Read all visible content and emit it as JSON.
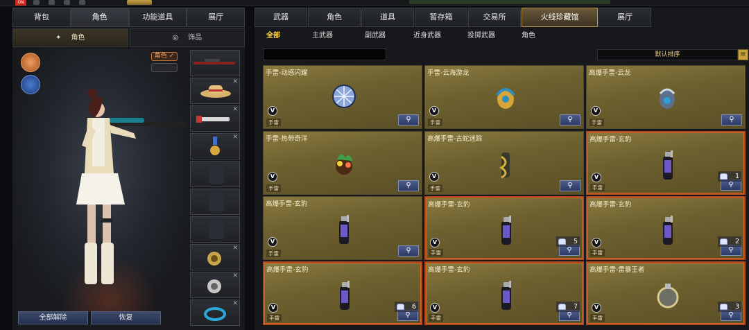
{
  "top_strip": {
    "on_label": "ON"
  },
  "left_panel": {
    "tabs": [
      "背包",
      "角色",
      "功能道具",
      "展厅"
    ],
    "active_tab": 1,
    "subtabs": [
      {
        "label": "角色",
        "icon": "character-icon"
      },
      {
        "label": "饰品",
        "icon": "ring-icon"
      }
    ],
    "role_badge": "角色 ✓",
    "buttons": {
      "unequip_all": "全部解除",
      "restore": "恢复"
    }
  },
  "right_panel": {
    "tabs": [
      "武器",
      "角色",
      "道具",
      "暂存箱",
      "交易所",
      "火线珍藏馆",
      "展厅"
    ],
    "active_tab": 5,
    "categories": [
      "全部",
      "主武器",
      "副武器",
      "近身武器",
      "投掷武器",
      "角色"
    ],
    "active_category": 0,
    "search": {
      "value": "",
      "placeholder": ""
    },
    "sort_label": "默认排序",
    "items": [
      {
        "name": "手雷-动感闪耀",
        "tag": "手雷",
        "stack": null,
        "art": "disco"
      },
      {
        "name": "手雷-云海游龙",
        "tag": "手雷",
        "stack": null,
        "art": "dragon"
      },
      {
        "name": "高爆手雷-云龙",
        "tag": "手雷",
        "stack": null,
        "art": "cloud"
      },
      {
        "name": "手雷-热带奇洋",
        "tag": "手雷",
        "stack": null,
        "art": "tropic"
      },
      {
        "name": "高爆手雷-古蛇迷踪",
        "tag": "手雷",
        "stack": null,
        "art": "snake"
      },
      {
        "name": "高爆手雷-玄豹",
        "tag": "手雷",
        "stack": "1",
        "art": "panther"
      },
      {
        "name": "高爆手雷-玄豹",
        "tag": "手雷",
        "stack": null,
        "art": "panther"
      },
      {
        "name": "高爆手雷-玄豹",
        "tag": "手雷",
        "stack": "5",
        "art": "panther"
      },
      {
        "name": "高爆手雷-玄豹",
        "tag": "手雷",
        "stack": "2",
        "art": "panther"
      },
      {
        "name": "高爆手雷-玄豹",
        "tag": "手雷",
        "stack": "6",
        "art": "panther"
      },
      {
        "name": "高爆手雷-玄豹",
        "tag": "手雷",
        "stack": "7",
        "art": "panther"
      },
      {
        "name": "高爆手雷-雷暴王者",
        "tag": "手雷",
        "stack": "3",
        "art": "thunder"
      }
    ]
  },
  "colors": {
    "accent_gold": "#ffd34a",
    "stack_border": "#b3491f",
    "button_blue": "#2c3a66"
  }
}
